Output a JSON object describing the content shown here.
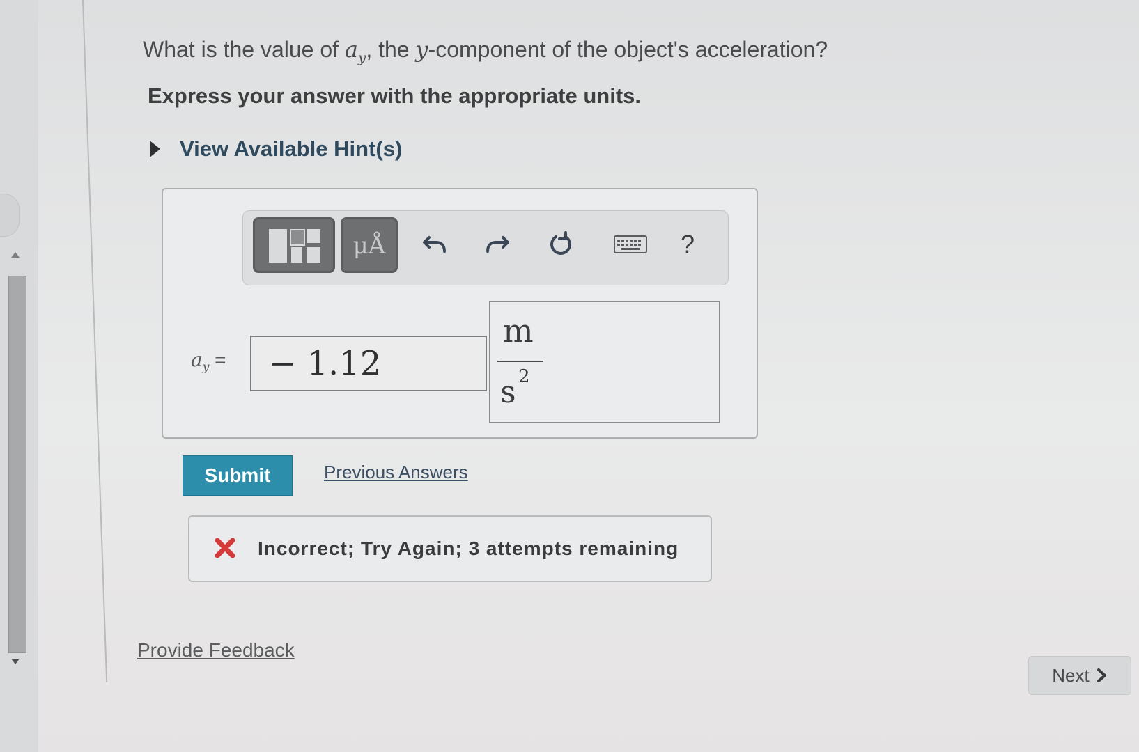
{
  "question": {
    "prefix": "What is the value of ",
    "var_symbol": "a",
    "var_subscript": "y",
    "middle": ", the ",
    "component_symbol": "y",
    "suffix": "-component of the object's acceleration?"
  },
  "instruction": "Express your answer with the appropriate units.",
  "hints_label": "View Available Hint(s)",
  "toolbar": {
    "units_label": "μÅ",
    "help_label": "?",
    "icons": [
      "templates-icon",
      "units-icon",
      "undo-icon",
      "redo-icon",
      "reset-icon",
      "keyboard-icon",
      "help-icon"
    ]
  },
  "answer": {
    "label_symbol": "a",
    "label_subscript": "y",
    "label_equals": "=",
    "value": "− 1.12",
    "unit_numerator": "m",
    "unit_denominator": "s",
    "unit_exponent": "2"
  },
  "submit_label": "Submit",
  "previous_answers_label": "Previous Answers",
  "feedback": {
    "status": "incorrect",
    "message": "Incorrect; Try Again; 3 attempts remaining",
    "color": "#d63a3a"
  },
  "provide_feedback_label": "Provide Feedback",
  "next_label": "Next",
  "colors": {
    "submit_bg": "#2c8eaa",
    "link": "#3d4f63",
    "error": "#d63a3a"
  }
}
